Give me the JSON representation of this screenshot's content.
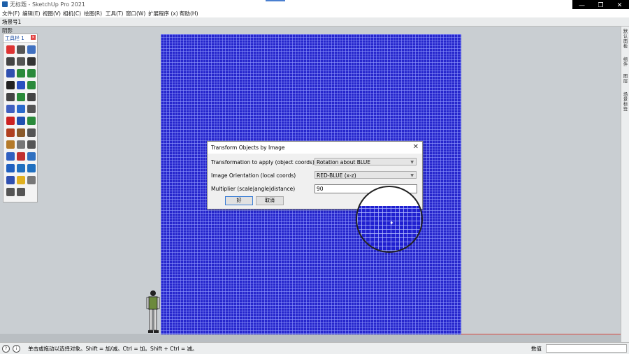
{
  "window": {
    "title": "无标题 - SketchUp Pro 2021",
    "controls": [
      "—",
      "❐",
      "✕"
    ]
  },
  "menu": [
    "文件(F)",
    "编辑(E)",
    "视图(V)",
    "相机(C)",
    "绘图(R)",
    "工具(T)",
    "窗口(W)",
    "扩展程序 (x)",
    "帮助(H)"
  ],
  "scene_tab": "场景号1",
  "shadow_label": "阴影",
  "toolbar": {
    "title": "工具栏 1",
    "close": "×"
  },
  "tool_colors": [
    "#d33",
    "#555",
    "#4070c0",
    "#444",
    "#555",
    "#333",
    "#3050b0",
    "#2a8a3a",
    "#2a8a3a",
    "#222",
    "#2a50c0",
    "#2a8a3a",
    "#444",
    "#2a8a3a",
    "#444",
    "#4060c0",
    "#2a6acc",
    "#555",
    "#c22",
    "#2050b0",
    "#2a8a3a",
    "#b04020",
    "#8a5a2a",
    "#555",
    "#b47a2a",
    "#777",
    "#555",
    "#3060c0",
    "#c03030",
    "#3070c0",
    "#2060c0",
    "#2070c0",
    "#2070c0",
    "#3050b0",
    "#e0b020",
    "#777",
    "#555",
    "#555"
  ],
  "dialog": {
    "title": "Transform Objects by Image",
    "close": "✕",
    "fields": [
      {
        "label": "Transformation to apply (object coords)",
        "value": "Rotation about BLUE"
      },
      {
        "label": "Image Orientation (local coords)",
        "value": "RED-BLUE (x-z)"
      }
    ],
    "multiplier_label": "Multiplier (scale|angle|distance)",
    "multiplier_value": "90",
    "ok": "好",
    "cancel": "取消"
  },
  "right_panel": [
    "默认面板",
    "组件",
    "图层",
    "场景标签"
  ],
  "status": {
    "message": "单击或拖动以选择对象。Shift = 加/减。Ctrl = 加。Shift + Ctrl = 减。",
    "value_label": "数值",
    "icons": [
      "?",
      "i"
    ]
  },
  "colors": {
    "model_fill": "#2626cc",
    "grid_line": "#9aa2ff",
    "axis_red": "#d9443c",
    "viewport_bg": "#c9ced2"
  }
}
